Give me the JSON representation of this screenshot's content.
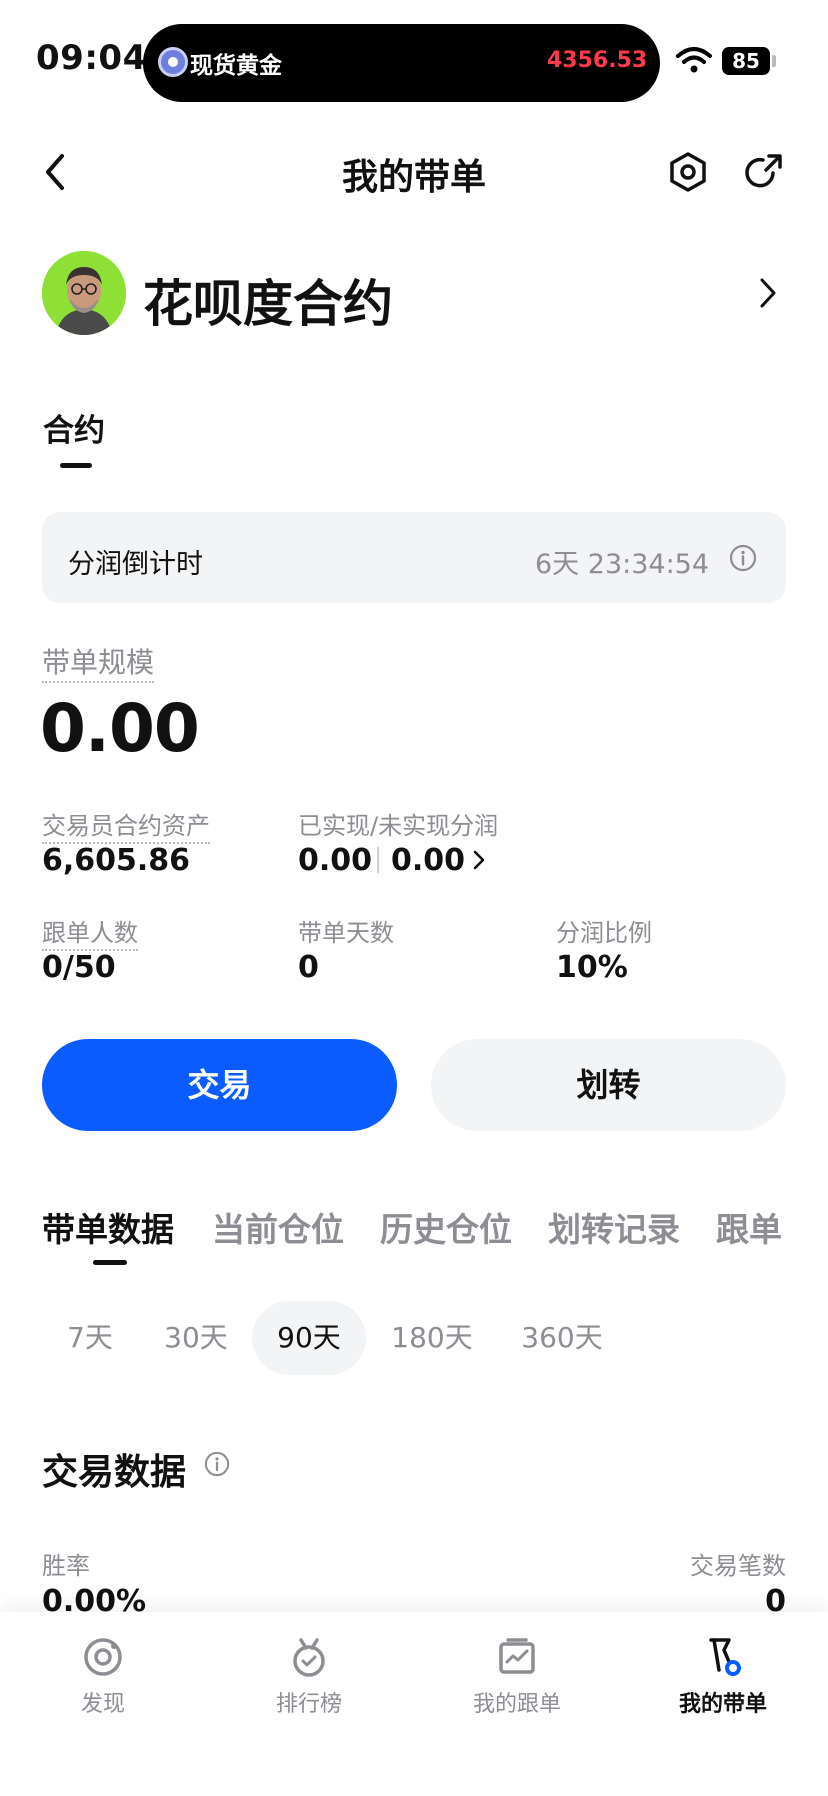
{
  "status_bar": {
    "time": "09:04",
    "island_name": "现货黄金",
    "island_price": "4356.53",
    "battery": "85"
  },
  "header": {
    "title": "我的带单",
    "icons": [
      "back-arrow-icon",
      "settings-hexagon-icon",
      "share-icon"
    ]
  },
  "profile": {
    "name": "花呗度合约"
  },
  "contract_tab": "合约",
  "countdown": {
    "label": "分润倒计时",
    "value": "6天 23:34:54"
  },
  "scale": {
    "label": "带单规模",
    "value": "0.00"
  },
  "stats": {
    "trader_assets_label": "交易员合约资产",
    "trader_assets_value": "6,605.86",
    "profit_share_label": "已实现/未实现分润",
    "realized": "0.00",
    "unrealized": "0.00",
    "followers_label": "跟单人数",
    "followers_value": "0/50",
    "days_label": "带单天数",
    "days_value": "0",
    "ratio_label": "分润比例",
    "ratio_value": "10%"
  },
  "buttons": {
    "trade": "交易",
    "transfer": "划转"
  },
  "section_tabs": [
    "带单数据",
    "当前仓位",
    "历史仓位",
    "划转记录",
    "跟单"
  ],
  "periods": [
    "7天",
    "30天",
    "90天",
    "180天",
    "360天"
  ],
  "active_period": "90天",
  "trade_data": {
    "title": "交易数据",
    "win_rate_label": "胜率",
    "win_rate_value": "0.00%",
    "trade_count_label": "交易笔数",
    "trade_count_value": "0"
  },
  "bottom_nav": {
    "items": [
      {
        "label": "发现",
        "icon": "discover-icon"
      },
      {
        "label": "排行榜",
        "icon": "medal-icon"
      },
      {
        "label": "我的跟单",
        "icon": "chart-board-icon"
      },
      {
        "label": "我的带单",
        "icon": "flag-icon"
      }
    ],
    "active": "我的带单"
  },
  "colors": {
    "primary": "#0a5cff",
    "price_red": "#ff3b4a",
    "muted_text": "#8d8d93",
    "pill_bg": "#f3f4f6"
  }
}
